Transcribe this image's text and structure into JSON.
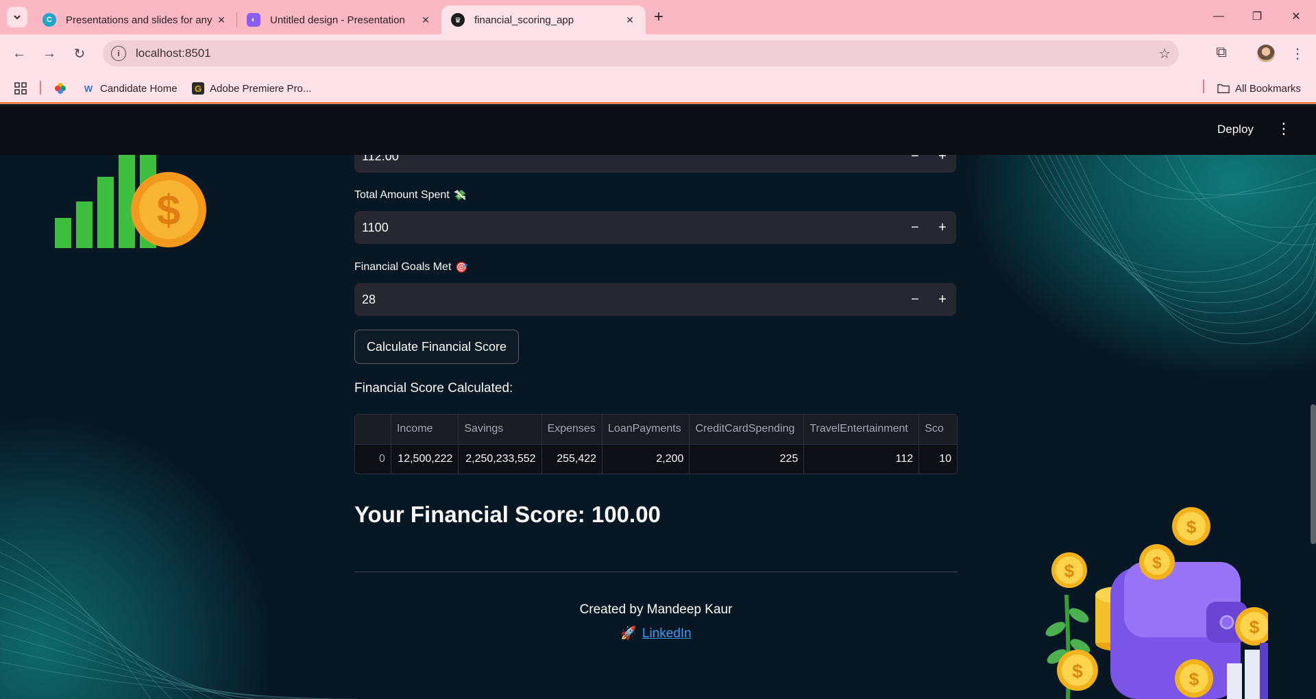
{
  "browser": {
    "tabs": [
      {
        "title": "Presentations and slides for any",
        "icon": "canva-icon",
        "active": false
      },
      {
        "title": "Untitled design - Presentation",
        "icon": "presentation-icon",
        "active": false
      },
      {
        "title": "financial_scoring_app",
        "icon": "streamlit-icon",
        "active": true
      }
    ],
    "url": "localhost:8501",
    "bookmarks": [
      {
        "label": "Candidate Home",
        "icon": "w-icon"
      },
      {
        "label": "Adobe Premiere Pro...",
        "icon": "g-icon"
      }
    ],
    "all_bookmarks": "All Bookmarks"
  },
  "header": {
    "deploy_label": "Deploy"
  },
  "form": {
    "partial_value": "112.00",
    "total_spent_label": "Total Amount Spent",
    "total_spent_value": "1100",
    "goals_label": "Financial Goals Met",
    "goals_value": "28",
    "calculate_label": "Calculate Financial Score"
  },
  "result": {
    "section_label": "Financial Score Calculated:",
    "table": {
      "columns": [
        "",
        "Income",
        "Savings",
        "Expenses",
        "LoanPayments",
        "CreditCardSpending",
        "TravelEntertainment",
        "Sco"
      ],
      "rows": [
        [
          "0",
          "12,500,222",
          "2,250,233,552",
          "255,422",
          "2,200",
          "225",
          "112",
          "10"
        ]
      ]
    },
    "score_text": "Your Financial Score: 100.00"
  },
  "footer": {
    "credit": "Created by Mandeep Kaur",
    "link_label": "LinkedIn"
  },
  "colors": {
    "accent": "#3a9cf5",
    "background": "#071824",
    "input_bg": "#262730"
  }
}
